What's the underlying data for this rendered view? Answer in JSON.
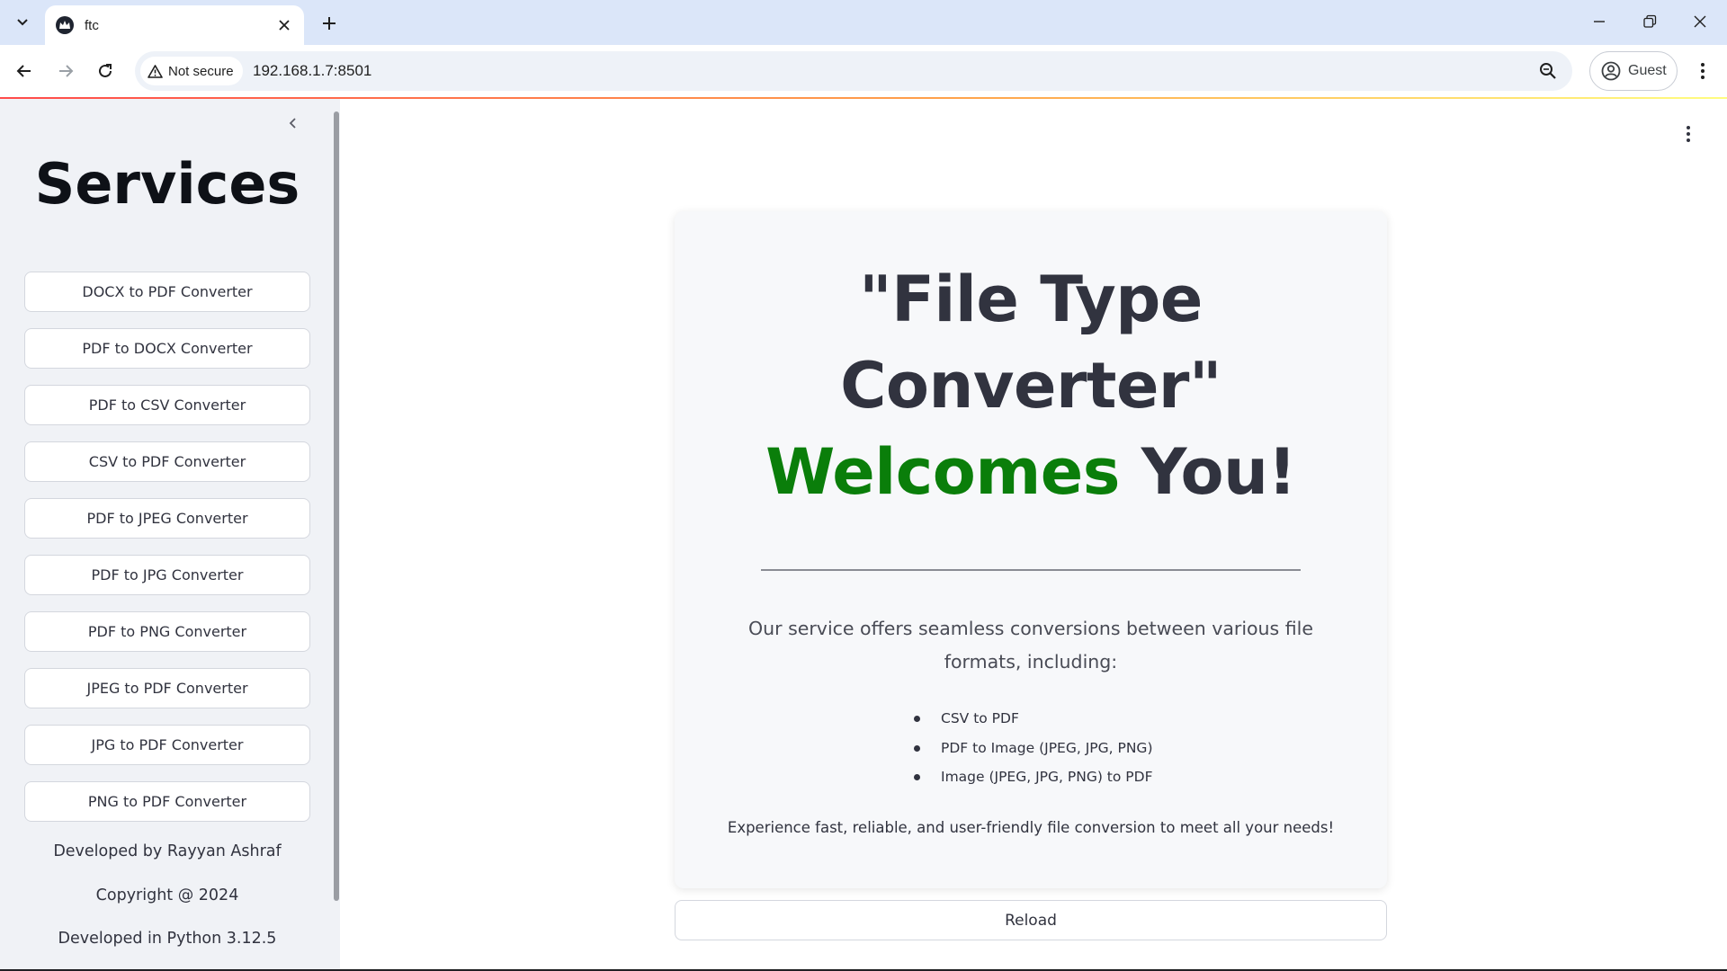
{
  "browser": {
    "tab_title": "ftc",
    "security_chip": "Not secure",
    "url": "192.168.1.7:8501",
    "profile_label": "Guest",
    "icons": {
      "tab_list": "chevron-down-icon",
      "favicon": "crown-icon",
      "tab_close": "close-icon",
      "new_tab": "plus-icon",
      "minimize": "minimize-icon",
      "restore": "restore-icon",
      "close_window": "close-icon",
      "back": "arrow-left-icon",
      "forward": "arrow-right-icon",
      "reload": "reload-icon",
      "warning": "warning-triangle-icon",
      "zoom": "zoom-icon",
      "profile": "person-circle-icon",
      "menu": "kebab-menu-icon"
    }
  },
  "sidebar": {
    "title": "Services",
    "buttons": [
      "DOCX to PDF Converter",
      "PDF to DOCX Converter",
      "PDF to CSV Converter",
      "CSV to PDF Converter",
      "PDF to JPEG Converter",
      "PDF to JPG Converter",
      "PDF to PNG Converter",
      "JPEG to PDF Converter",
      "JPG to PDF Converter",
      "PNG to PDF Converter"
    ],
    "footer": [
      "Developed by Rayyan Ashraf",
      "Copyright @ 2024",
      "Developed in Python 3.12.5"
    ]
  },
  "main": {
    "headline_line1": "\"File Type",
    "headline_line2": "Converter\"",
    "headline_welcome": "Welcomes",
    "headline_you": "You!",
    "intro": "Our service offers seamless conversions between various file formats, including:",
    "features": [
      "CSV to PDF",
      "PDF to Image (JPEG, JPG, PNG)",
      "Image (JPEG, JPG, PNG) to PDF"
    ],
    "closing": "Experience fast, reliable, and user-friendly file conversion to meet all your needs!",
    "reload_label": "Reload"
  },
  "colors": {
    "accent_green": "#0a7e0a",
    "text_dark": "#31333f",
    "sidebar_bg": "#f0f2f6",
    "tabbar_bg": "#dbe6f9"
  }
}
